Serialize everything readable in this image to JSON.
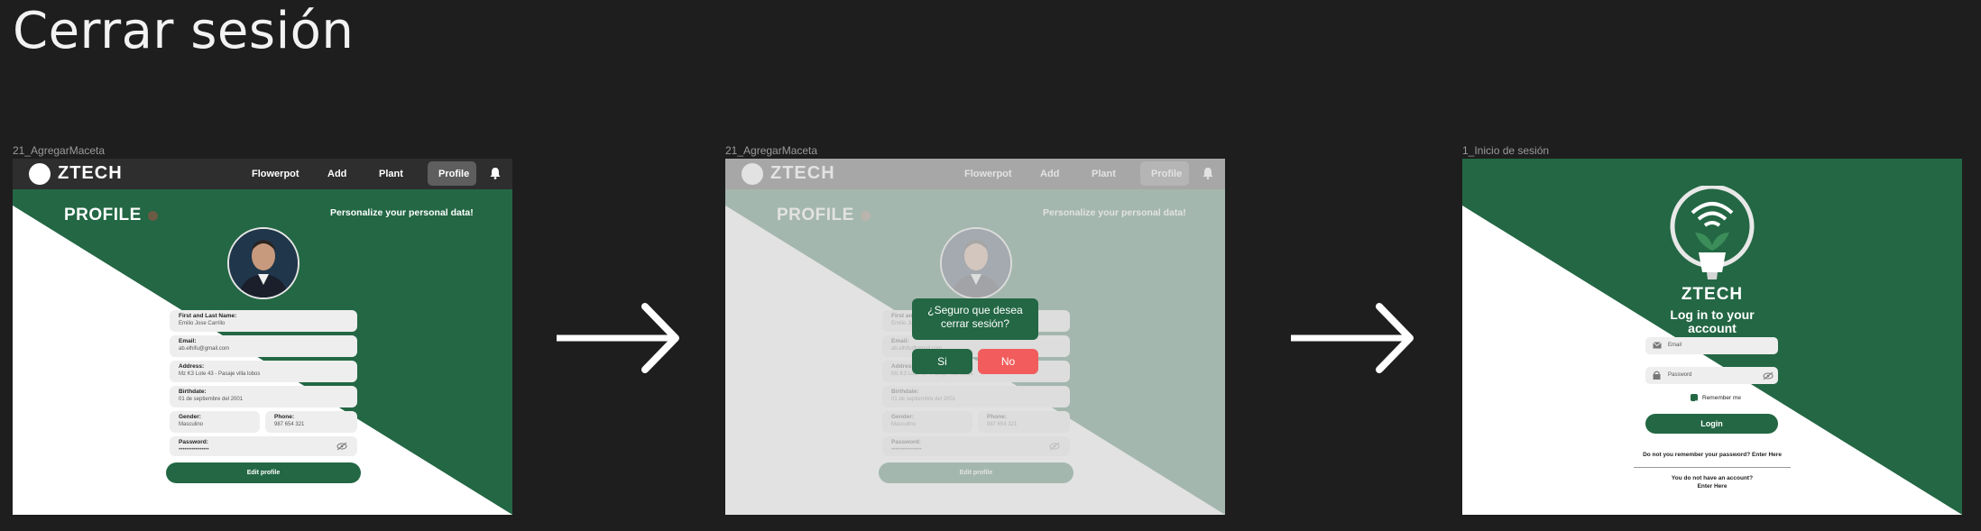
{
  "page_title": "Cerrar sesión",
  "colors": {
    "green": "#236744",
    "dark": "#1e1e1e",
    "navbar": "#2e2e2e",
    "danger": "#f25c5c"
  },
  "frames": [
    {
      "label": "21_AgregarMaceta"
    },
    {
      "label": "21_AgregarMaceta"
    },
    {
      "label": "1_Inicio de sesión"
    }
  ],
  "navbar": {
    "brand": "ZTECH",
    "items": [
      "Flowerpot",
      "Add",
      "Plant",
      "Profile"
    ],
    "bell_icon": "bell-icon"
  },
  "profile": {
    "heading": "PROFILE",
    "subtitle": "Personalize your personal data!",
    "fields": {
      "name": {
        "label": "First and Last Name:",
        "value": "Emilio Jose Carrillo"
      },
      "email": {
        "label": "Email:",
        "value": "ab.elhifu@gmail.com"
      },
      "address": {
        "label": "Address:",
        "value": "Mz K3 Lote 43 - Pasaje villa lobos"
      },
      "birthdate": {
        "label": "Birthdate:",
        "value": "01 de septiembre del 2001"
      },
      "gender": {
        "label": "Gender:",
        "value": "Masculino"
      },
      "phone": {
        "label": "Phone:",
        "value": "987 654 321"
      },
      "password": {
        "label": "Password:",
        "value": "••••••••••••••••"
      }
    },
    "edit_button": "Edit profile"
  },
  "logout_dialog": {
    "question": "¿Seguro que desea cerrar sesión?",
    "yes": "Si",
    "no": "No"
  },
  "login": {
    "brand": "ZTECH",
    "heading": "Log in to your account",
    "email_placeholder": "Email",
    "password_placeholder": "Password",
    "remember": "Remember me",
    "button": "Login",
    "forgot": "Do not you remember your password? Enter Here",
    "no_account": "You do not have an account?",
    "enter_here": "Enter Here"
  }
}
